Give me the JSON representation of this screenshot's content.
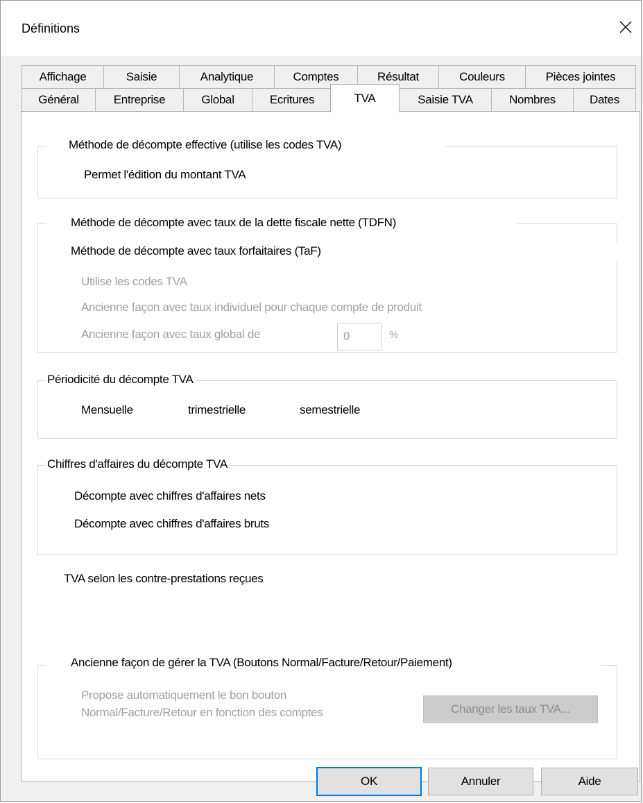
{
  "window": {
    "title": "Définitions"
  },
  "tabs": {
    "row1": [
      "Affichage",
      "Saisie",
      "Analytique",
      "Comptes",
      "Résultat",
      "Couleurs",
      "Pièces jointes"
    ],
    "row2": [
      "Général",
      "Entreprise",
      "Global",
      "Ecritures",
      "TVA",
      "Saisie TVA",
      "Nombres",
      "Dates"
    ],
    "active": "TVA"
  },
  "effective": {
    "checkbox_label": "Méthode de décompte effective (utilise les codes TVA)",
    "checked": true,
    "edit_amount_label": "Permet l'édition du montant TVA",
    "edit_amount_checked": false
  },
  "rates": {
    "tdfn_label": "Méthode de décompte avec taux de la dette fiscale nette (TDFN)",
    "taf_label": "Méthode de décompte avec taux forfaitaires (TaF)",
    "option_codes": "Utilise les codes TVA",
    "option_individual": "Ancienne façon avec taux individuel pour chaque compte de produit",
    "option_global": "Ancienne façon avec taux global  de",
    "global_rate_value": "0",
    "percent_sign": "%"
  },
  "periodicity": {
    "legend": "Périodicité du décompte TVA",
    "options": [
      "Mensuelle",
      "trimestrielle",
      "semestrielle"
    ],
    "selected": "trimestrielle"
  },
  "turnover": {
    "legend": "Chiffres d'affaires du décompte TVA",
    "options": [
      "Décompte avec chiffres d'affaires nets",
      "Décompte avec chiffres d'affaires bruts"
    ],
    "selected": "Décompte avec chiffres d'affaires nets"
  },
  "counter_performance": {
    "label": "TVA selon les contre-prestations reçues",
    "checked": false
  },
  "legacy": {
    "label": "Ancienne façon de gérer la TVA (Boutons Normal/Facture/Retour/Paiement)",
    "auto_line1": "Propose automatiquement le bon bouton",
    "auto_line2": "Normal/Facture/Retour en fonction des comptes",
    "change_rates_button": "Changer les taux TVA..."
  },
  "footer": {
    "ok": "OK",
    "cancel": "Annuler",
    "help": "Aide"
  }
}
